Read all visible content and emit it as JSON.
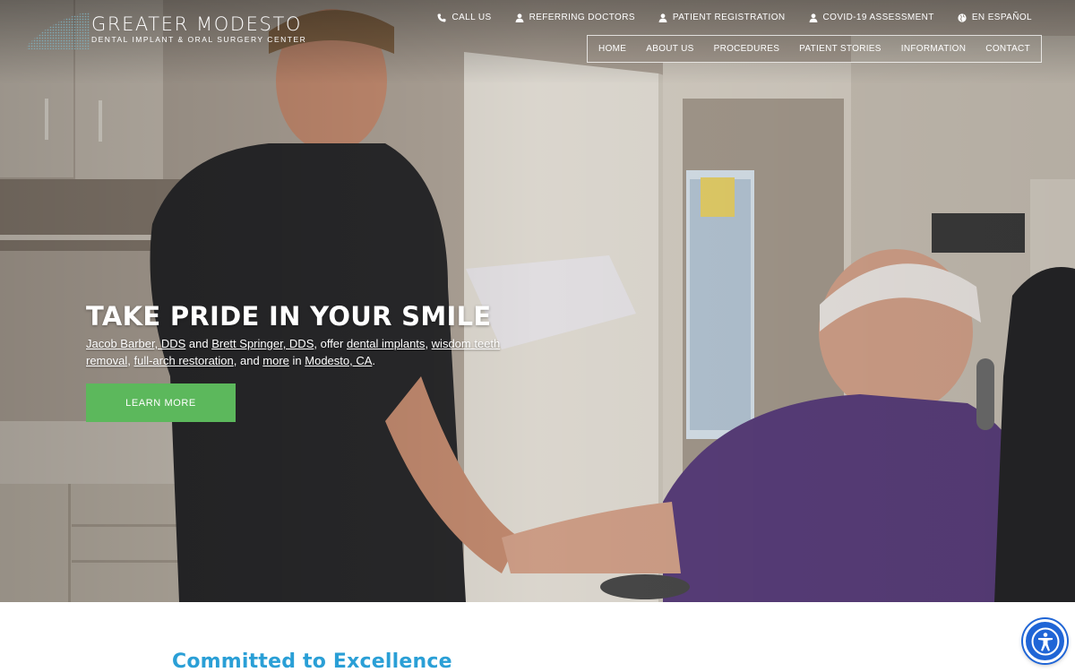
{
  "brand": {
    "title": "GREATER MODESTO",
    "subtitle": "DENTAL IMPLANT & ORAL SURGERY CENTER",
    "logo_icon": "dotted-globe-logo"
  },
  "utility_nav": [
    {
      "label": "CALL US",
      "icon": "phone-icon"
    },
    {
      "label": "REFERRING DOCTORS",
      "icon": "person-icon"
    },
    {
      "label": "PATIENT REGISTRATION",
      "icon": "person-icon"
    },
    {
      "label": "COVID-19 ASSESSMENT",
      "icon": "person-icon"
    },
    {
      "label": "EN ESPAÑOL",
      "icon": "globe-icon"
    }
  ],
  "main_nav": [
    "HOME",
    "ABOUT US",
    "PROCEDURES",
    "PATIENT STORIES",
    "INFORMATION",
    "CONTACT"
  ],
  "hero": {
    "headline": "TAKE PRIDE IN YOUR SMILE",
    "intro": {
      "doctor1": "Jacob Barber, DDS",
      "and": " and ",
      "doctor2": "Brett Springer, DDS",
      "offer": ", offer ",
      "link1": "dental implants",
      "comma1": ", ",
      "link2": "wisdom teeth removal",
      "comma2": ", ",
      "link3": "full-arch restoration",
      "and2": ", and ",
      "link4": "more",
      "in": " in ",
      "location": "Modesto, CA",
      "period": "."
    },
    "cta_label": "LEARN MORE"
  },
  "section": {
    "title": "Committed to Excellence"
  },
  "accessibility_button": {
    "icon": "accessibility-icon"
  },
  "colors": {
    "cta": "#5cb85c",
    "section_title": "#2a9fd6",
    "accessibility": "#1f65d6"
  }
}
